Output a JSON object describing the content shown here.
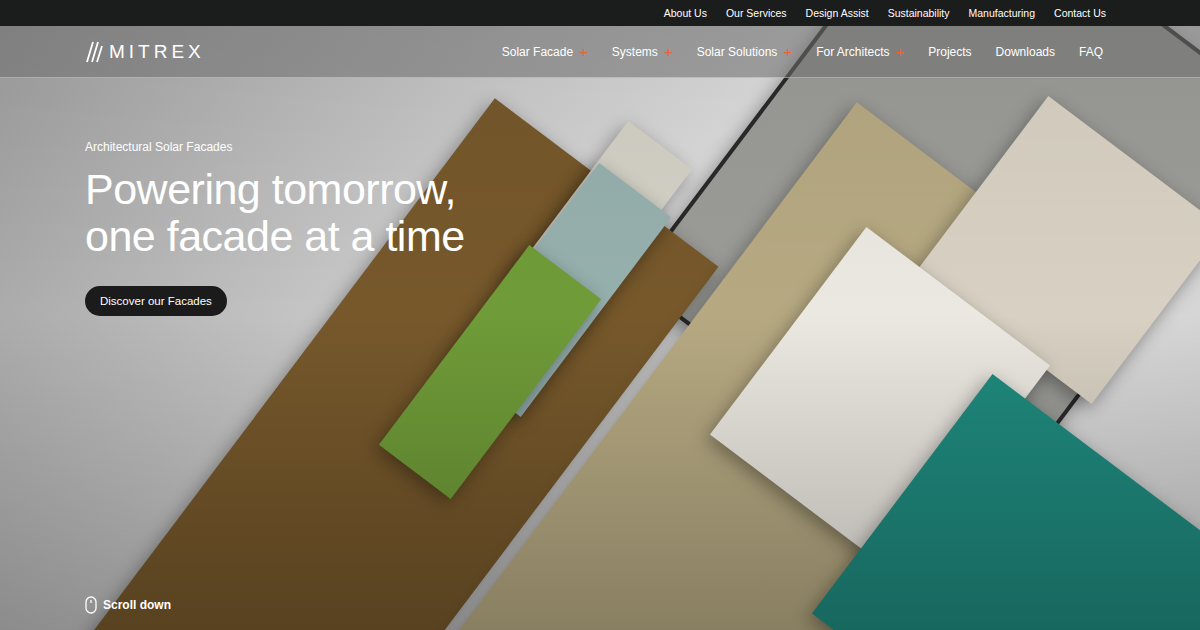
{
  "top_bar": {
    "links": [
      "About Us",
      "Our Services",
      "Design Assist",
      "Sustainability",
      "Manufacturing",
      "Contact Us"
    ]
  },
  "header": {
    "logo": "MITREX",
    "expand_glyph": "+",
    "nav": [
      {
        "label": "Solar Facade",
        "expandable": true
      },
      {
        "label": "Systems",
        "expandable": true
      },
      {
        "label": "Solar Solutions",
        "expandable": true
      },
      {
        "label": "For Architects",
        "expandable": true
      },
      {
        "label": "Projects",
        "expandable": false
      },
      {
        "label": "Downloads",
        "expandable": false
      },
      {
        "label": "FAQ",
        "expandable": false
      }
    ]
  },
  "hero": {
    "eyebrow": "Architectural Solar Facades",
    "headline": [
      "Powering tomorrow,",
      "one facade at a time"
    ],
    "button": "Discover our Facades",
    "scroll": "Scroll down"
  }
}
